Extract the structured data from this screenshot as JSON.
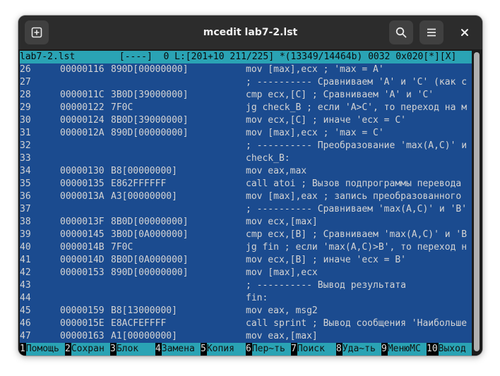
{
  "window": {
    "title": "mcedit lab7-2.lst"
  },
  "colors": {
    "editor_bg": "#1b4b8f",
    "status_bg": "#2aa3b4",
    "fkey_label_bg": "#2aa3b4"
  },
  "header_icons": {
    "new_tab": "plus-square-icon",
    "search": "search-icon",
    "menu": "hamburger-menu-icon",
    "close": "close-icon"
  },
  "status_line": "lab7-2.lst        [----]  0 L:[201+10 211/225] *(13349/14464b) 0032 0x020[*][X]",
  "lines": [
    {
      "ln": "26",
      "addr": "00000116",
      "hex": "890D[00000000]",
      "src": "mov [max],ecx ; 'max = A'"
    },
    {
      "ln": "27",
      "addr": "",
      "hex": "",
      "src": "; ---------- Сравниваем 'A' и 'C' (как с"
    },
    {
      "ln": "28",
      "addr": "0000011C",
      "hex": "3B0D[39000000]",
      "src": "cmp ecx,[C] ; Сравниваем 'A' и 'C'"
    },
    {
      "ln": "29",
      "addr": "00000122",
      "hex": "7F0C",
      "src": "jg check_B ; если 'A>C', то переход на м"
    },
    {
      "ln": "30",
      "addr": "00000124",
      "hex": "8B0D[39000000]",
      "src": "mov ecx,[C] ; иначе 'ecx = C'"
    },
    {
      "ln": "31",
      "addr": "0000012A",
      "hex": "890D[00000000]",
      "src": "mov [max],ecx ; 'max = C'"
    },
    {
      "ln": "32",
      "addr": "",
      "hex": "",
      "src": "; ---------- Преобразование 'max(A,C)' и"
    },
    {
      "ln": "33",
      "addr": "",
      "hex": "",
      "src": "check_B:"
    },
    {
      "ln": "34",
      "addr": "00000130",
      "hex": "B8[00000000]",
      "src": "mov eax,max"
    },
    {
      "ln": "35",
      "addr": "00000135",
      "hex": "E862FFFFFF",
      "src": "call atoi ; Вызов подпрограммы перевода"
    },
    {
      "ln": "36",
      "addr": "0000013A",
      "hex": "A3[00000000]",
      "src": "mov [max],eax ; запись преобразованного"
    },
    {
      "ln": "37",
      "addr": "",
      "hex": "",
      "src": "; ---------- Сравниваем 'max(A,C)' и 'B'"
    },
    {
      "ln": "38",
      "addr": "0000013F",
      "hex": "8B0D[00000000]",
      "src": "mov ecx,[max]"
    },
    {
      "ln": "39",
      "addr": "00000145",
      "hex": "3B0D[0A000000]",
      "src": "cmp ecx,[B] ; Сравниваем 'max(A,C)' и 'B"
    },
    {
      "ln": "40",
      "addr": "0000014B",
      "hex": "7F0C",
      "src": "jg fin ; если 'max(A,C)>B', то переход н"
    },
    {
      "ln": "41",
      "addr": "0000014D",
      "hex": "8B0D[0A000000]",
      "src": "mov ecx,[B] ; иначе 'ecx = B'"
    },
    {
      "ln": "42",
      "addr": "00000153",
      "hex": "890D[00000000]",
      "src": "mov [max],ecx"
    },
    {
      "ln": "43",
      "addr": "",
      "hex": "",
      "src": "; ---------- Вывод результата"
    },
    {
      "ln": "44",
      "addr": "",
      "hex": "",
      "src": "fin:"
    },
    {
      "ln": "45",
      "addr": "00000159",
      "hex": "B8[13000000]",
      "src": "mov eax, msg2"
    },
    {
      "ln": "46",
      "addr": "0000015E",
      "hex": "E8ACFEFFFF",
      "src": "call sprint ; Вывод сообщения 'Наибольше"
    },
    {
      "ln": "47",
      "addr": "00000163",
      "hex": "A1[00000000]",
      "src": "mov eax,[max]"
    }
  ],
  "fkeys": [
    {
      "num": "1",
      "label": "Помощь"
    },
    {
      "num": "2",
      "label": "Сохран"
    },
    {
      "num": "3",
      "label": "Блок"
    },
    {
      "num": "4",
      "label": "Замена"
    },
    {
      "num": "5",
      "label": "Копия"
    },
    {
      "num": "6",
      "label": "Пер~ть"
    },
    {
      "num": "7",
      "label": "Поиск"
    },
    {
      "num": "8",
      "label": "Уда~ть"
    },
    {
      "num": "9",
      "label": "МенюMC"
    },
    {
      "num": "10",
      "label": "Выход"
    }
  ]
}
